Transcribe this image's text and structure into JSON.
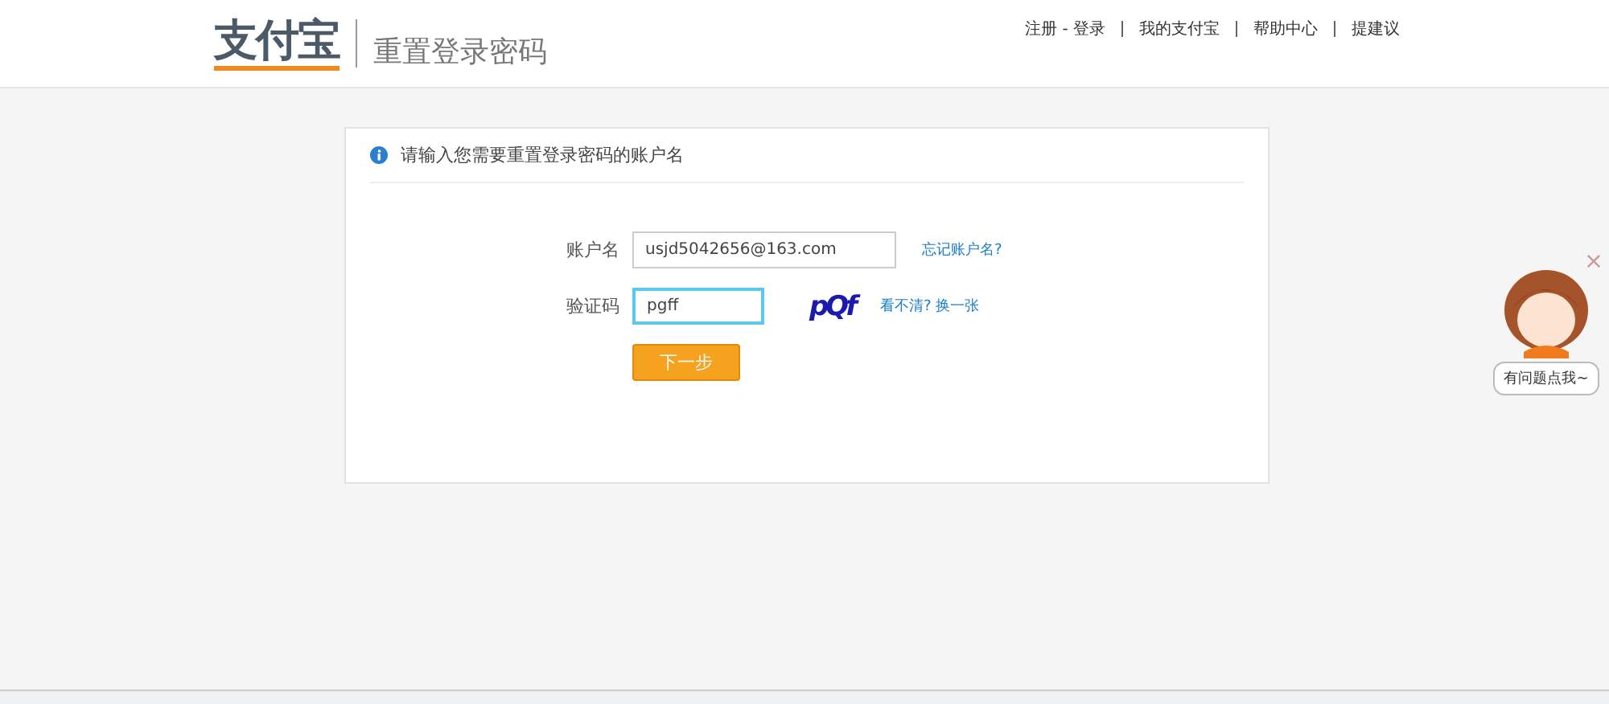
{
  "header": {
    "logo": "支付宝",
    "title": "重置登录密码",
    "nav": [
      "注册 - 登录",
      "我的支付宝",
      "帮助中心",
      "提建议"
    ]
  },
  "form": {
    "notice": "请输入您需要重置登录密码的账户名",
    "fields": [
      {
        "kind": "text",
        "label": "账户名",
        "value": "usjd5042656@163.com",
        "focused": false,
        "link": "忘记账户名?"
      },
      {
        "kind": "captcha",
        "label": "验证码",
        "value": "pgff",
        "focused": true,
        "captcha": "pQf",
        "link": "看不清? 换一张"
      }
    ],
    "submit": "下一步"
  },
  "helper": {
    "bubble": "有问题点我~"
  }
}
